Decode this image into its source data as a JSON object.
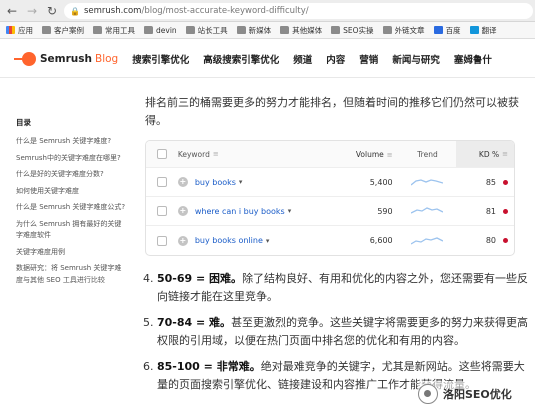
{
  "browser": {
    "url_host": "semrush.com",
    "url_path": "/blog/most-accurate-keyword-difficulty/",
    "bookmarks": [
      {
        "label": "应用",
        "icon": "apps-grid-icon"
      },
      {
        "label": "客户案例",
        "icon": "folder-icon"
      },
      {
        "label": "常用工具",
        "icon": "folder-icon"
      },
      {
        "label": "devin",
        "icon": "folder-icon"
      },
      {
        "label": "站长工具",
        "icon": "folder-icon"
      },
      {
        "label": "新媒体",
        "icon": "folder-icon"
      },
      {
        "label": "其他媒体",
        "icon": "folder-icon"
      },
      {
        "label": "SEO实操",
        "icon": "folder-icon"
      },
      {
        "label": "外链文章",
        "icon": "folder-icon"
      },
      {
        "label": "百度",
        "icon": "baidu-icon"
      },
      {
        "label": "翻译",
        "icon": "translate-icon"
      }
    ]
  },
  "header": {
    "brand": "Semrush",
    "brand_suffix": "Blog",
    "menu": [
      "搜索引擎优化",
      "高级搜索引擎优化",
      "频道",
      "内容",
      "营销",
      "新闻与研究",
      "塞姆鲁什"
    ]
  },
  "toc": {
    "title": "目录",
    "items": [
      "什么是 Semrush 关键字难度?",
      "Semrush中的关键字难度在哪里?",
      "什么是好的关键字难度分数?",
      "如何使用关键字难度",
      "什么是 Semrush 关键字难度公式?",
      "为什么 Semrush 拥有最好的关键字难度软件",
      "关键字难度用例",
      "数据研究：将 Semrush 关键字难度与其他 SEO 工具进行比较"
    ]
  },
  "main": {
    "intro": "排名前三的桶需要更多的努力才能排名，但随着时间的推移它们仍然可以被获得。",
    "table": {
      "headers": {
        "keyword": "Keyword",
        "volume": "Volume",
        "trend": "Trend",
        "kd": "KD %"
      },
      "rows": [
        {
          "keyword": "buy books",
          "volume": "5,400",
          "kd": "85"
        },
        {
          "keyword": "where can i buy books",
          "volume": "590",
          "kd": "81"
        },
        {
          "keyword": "buy books online",
          "volume": "6,600",
          "kd": "80"
        }
      ],
      "colors": {
        "link": "#1a5cc8",
        "kd_dot": "#c8102e",
        "trend": "#9cc3ee"
      }
    },
    "list": [
      {
        "num": "4.",
        "bold": "50-69 = 困难。",
        "text": "除了结构良好、有用和优化的内容之外，您还需要有一些反向链接才能在这里竞争。"
      },
      {
        "num": "5.",
        "bold": "70-84 = 难。",
        "text": "甚至更激烈的竞争。这些关键字将需要更多的努力来获得更高权限的引用域，以便在热门页面中排名您的优化和有用的内容。"
      },
      {
        "num": "6.",
        "bold": "85-100 = 非常难。",
        "text": "绝对最难竞争的关键字，尤其是新网站。这些将需要大量的页面搜索引擎优化、链接建设和内容推广工作才能获得流量。"
      }
    ]
  },
  "watermark": {
    "text": "洛阳SEO优化"
  },
  "colors": {
    "accent": "#ff642d"
  }
}
